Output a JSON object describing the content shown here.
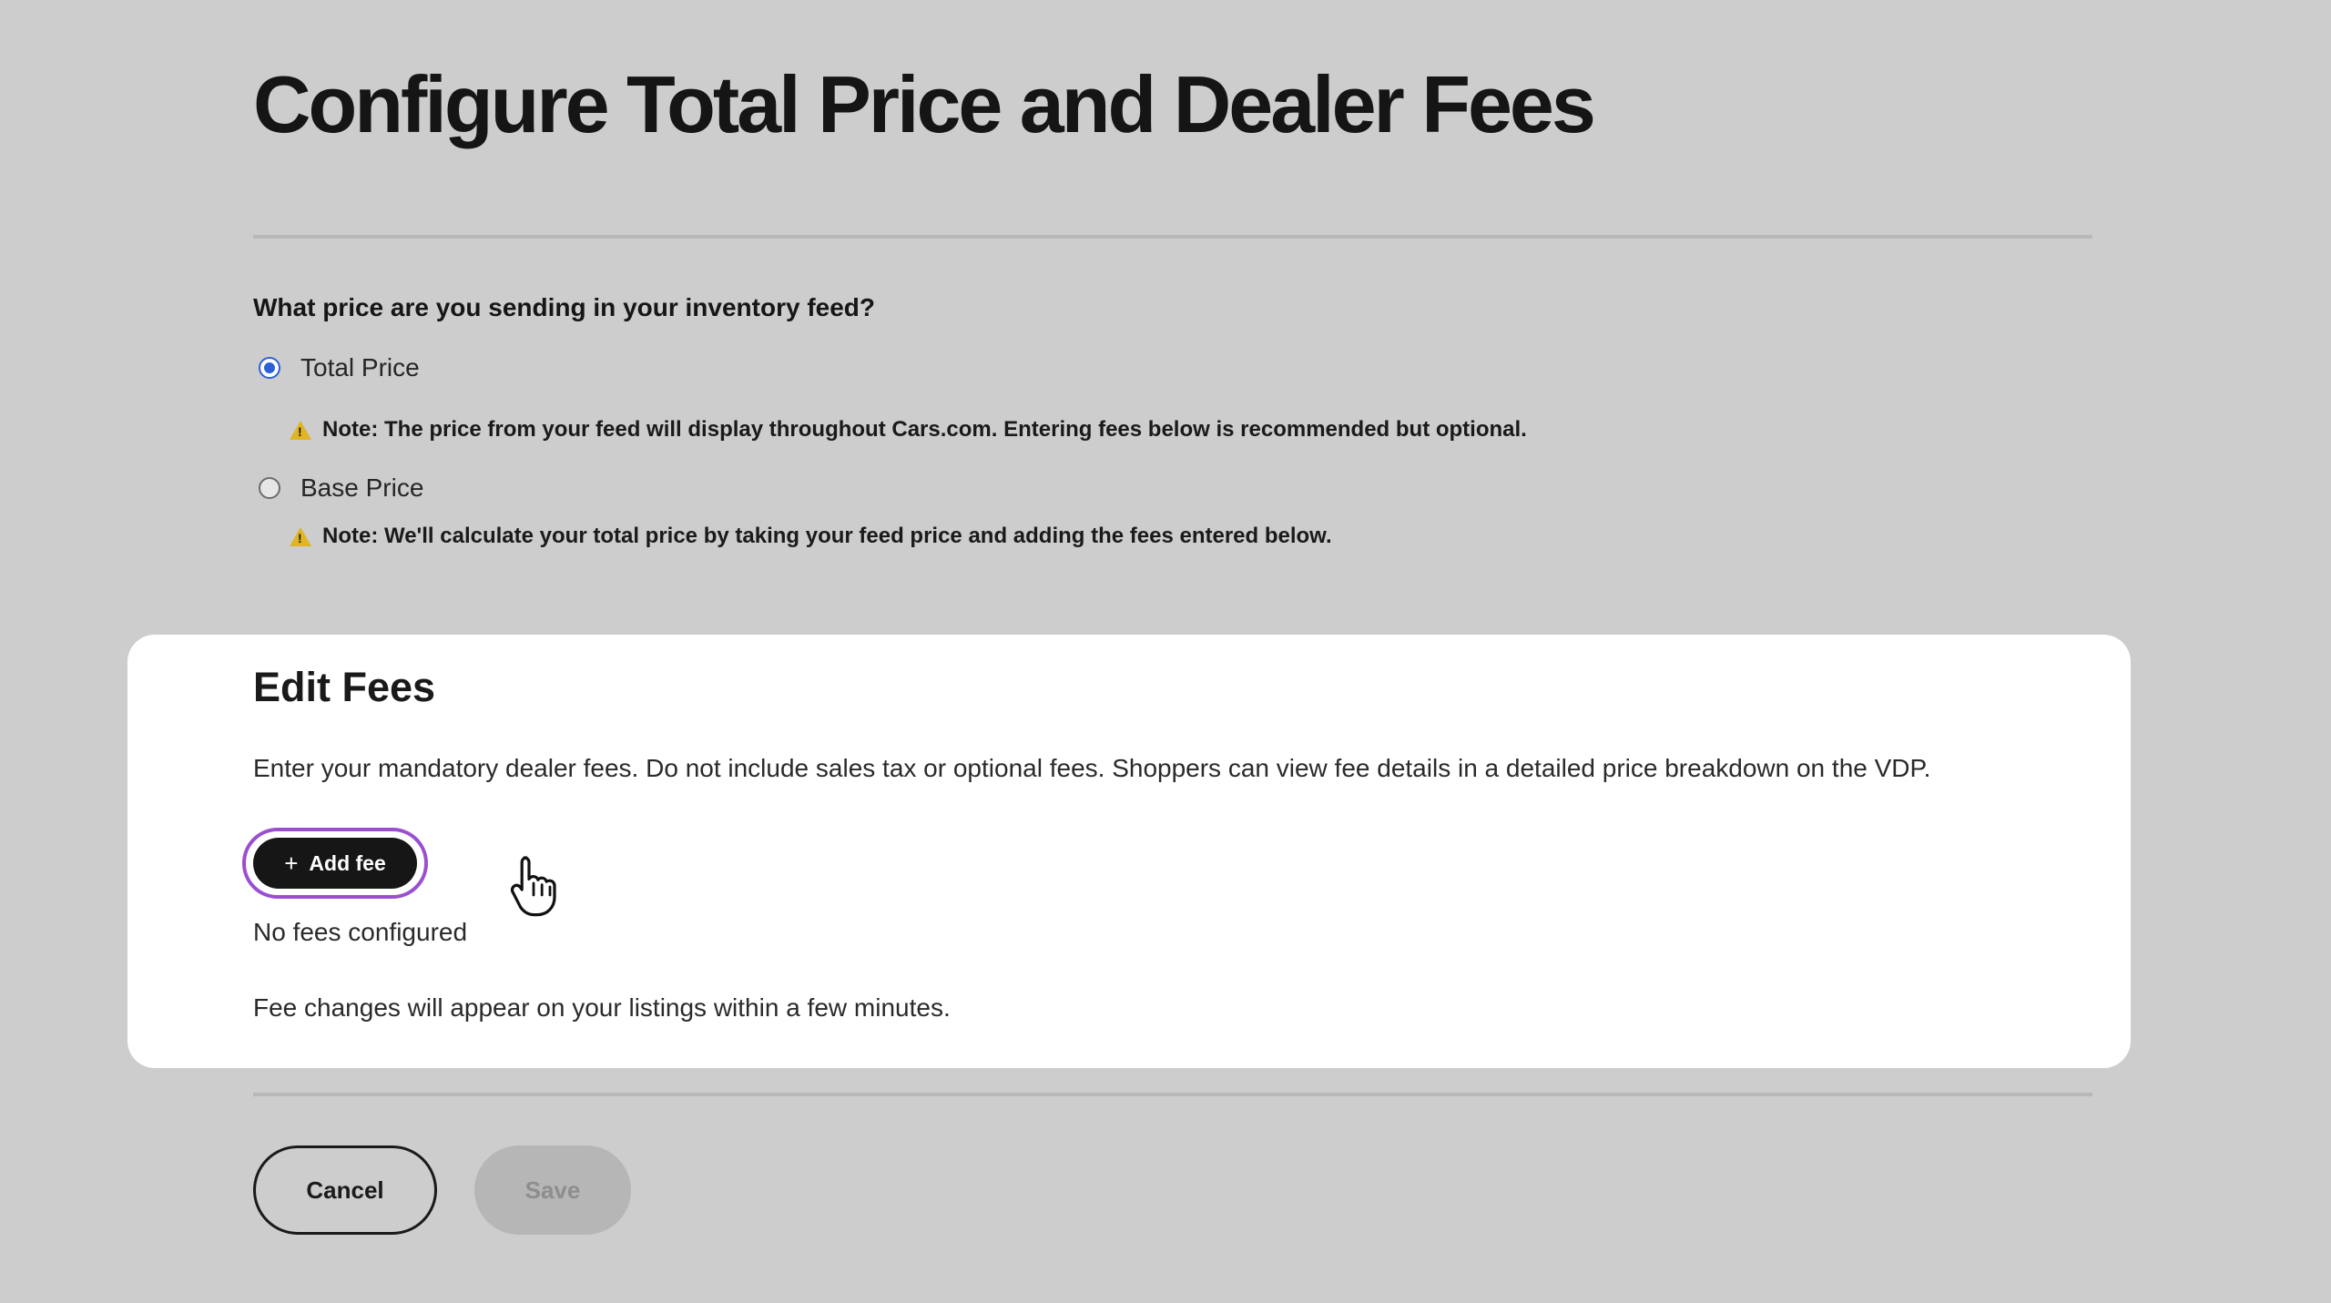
{
  "page": {
    "title": "Configure Total Price and Dealer Fees"
  },
  "price_question": {
    "label": "What price are you sending in your inventory feed?",
    "options": [
      {
        "label": "Total Price",
        "selected": true,
        "note": "Note: The price from your feed will display throughout Cars.com. Entering fees below is recommended but optional."
      },
      {
        "label": "Base Price",
        "selected": false,
        "note": "Note: We'll calculate your total price by taking your feed price and adding the fees entered below."
      }
    ]
  },
  "edit_fees": {
    "title": "Edit Fees",
    "description": "Enter your mandatory dealer fees. Do not include sales tax or optional fees. Shoppers can view fee details in a detailed price breakdown on the VDP.",
    "add_fee_label": "Add fee",
    "add_fee_icon": "plus-icon",
    "empty_state": "No fees configured",
    "footer_note": "Fee changes will appear on your listings within a few minutes."
  },
  "actions": {
    "cancel_label": "Cancel",
    "save_label": "Save",
    "save_enabled": false
  },
  "colors": {
    "background": "#cdcdcd",
    "card": "#ffffff",
    "radio_selected": "#2f5fd6",
    "warning": "#e0b422",
    "focus_ring": "#9b4fd0",
    "primary_button": "#161616",
    "disabled_button": "#b6b6b6"
  }
}
